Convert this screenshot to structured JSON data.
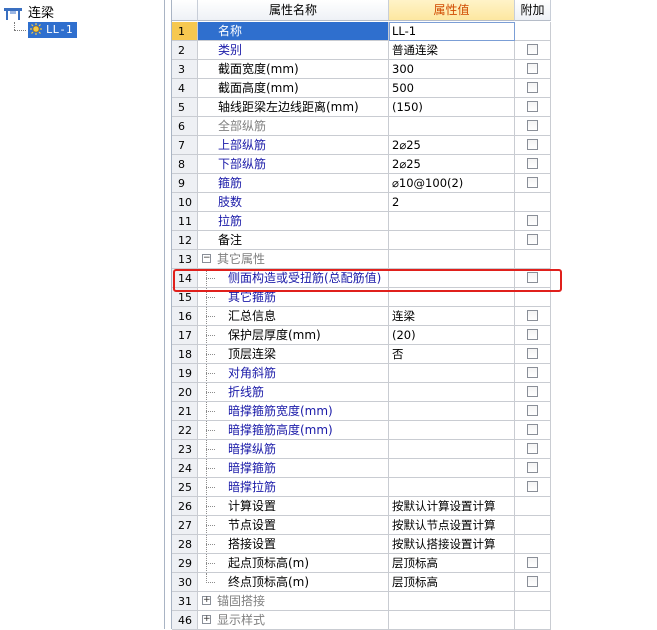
{
  "tree": {
    "root_label": "连梁",
    "child_label": "LL-1"
  },
  "grid": {
    "header": {
      "name": "属性名称",
      "value": "属性值",
      "extra": "附加"
    },
    "rows": [
      {
        "num": "1",
        "name": "名称",
        "value": "LL-1",
        "color": "blue",
        "checkbox": false,
        "tree": "",
        "selected": true
      },
      {
        "num": "2",
        "name": "类别",
        "value": "普通连梁",
        "color": "blue",
        "checkbox": true,
        "tree": ""
      },
      {
        "num": "3",
        "name": "截面宽度(mm)",
        "value": "300",
        "color": "black",
        "checkbox": true,
        "tree": ""
      },
      {
        "num": "4",
        "name": "截面高度(mm)",
        "value": "500",
        "color": "black",
        "checkbox": true,
        "tree": ""
      },
      {
        "num": "5",
        "name": "轴线距梁左边线距离(mm)",
        "value": "(150)",
        "color": "black",
        "checkbox": true,
        "tree": ""
      },
      {
        "num": "6",
        "name": "全部纵筋",
        "value": "",
        "color": "gray",
        "checkbox": true,
        "tree": ""
      },
      {
        "num": "7",
        "name": "上部纵筋",
        "value": "2⌀25",
        "color": "blue",
        "checkbox": true,
        "tree": ""
      },
      {
        "num": "8",
        "name": "下部纵筋",
        "value": "2⌀25",
        "color": "blue",
        "checkbox": true,
        "tree": ""
      },
      {
        "num": "9",
        "name": "箍筋",
        "value": "⌀10@100(2)",
        "color": "blue",
        "checkbox": true,
        "tree": ""
      },
      {
        "num": "10",
        "name": "肢数",
        "value": "2",
        "color": "blue",
        "checkbox": false,
        "tree": ""
      },
      {
        "num": "11",
        "name": "拉筋",
        "value": "",
        "color": "blue",
        "checkbox": true,
        "tree": ""
      },
      {
        "num": "12",
        "name": "备注",
        "value": "",
        "color": "black",
        "checkbox": true,
        "tree": ""
      },
      {
        "num": "13",
        "name": "其它属性",
        "value": "",
        "color": "gray",
        "checkbox": false,
        "tree": "collapse"
      },
      {
        "num": "14",
        "name": "侧面构造或受扭筋(总配筋值)",
        "value": "",
        "color": "blue",
        "checkbox": true,
        "tree": "line"
      },
      {
        "num": "15",
        "name": "其它箍筋",
        "value": "",
        "color": "blue",
        "checkbox": false,
        "tree": "line"
      },
      {
        "num": "16",
        "name": "汇总信息",
        "value": "连梁",
        "color": "black",
        "checkbox": true,
        "tree": "line"
      },
      {
        "num": "17",
        "name": "保护层厚度(mm)",
        "value": "(20)",
        "color": "black",
        "checkbox": true,
        "tree": "line"
      },
      {
        "num": "18",
        "name": "顶层连梁",
        "value": "否",
        "color": "black",
        "checkbox": true,
        "tree": "line"
      },
      {
        "num": "19",
        "name": "对角斜筋",
        "value": "",
        "color": "blue",
        "checkbox": true,
        "tree": "line"
      },
      {
        "num": "20",
        "name": "折线筋",
        "value": "",
        "color": "blue",
        "checkbox": true,
        "tree": "line"
      },
      {
        "num": "21",
        "name": "暗撑箍筋宽度(mm)",
        "value": "",
        "color": "blue",
        "checkbox": true,
        "tree": "line"
      },
      {
        "num": "22",
        "name": "暗撑箍筋高度(mm)",
        "value": "",
        "color": "blue",
        "checkbox": true,
        "tree": "line"
      },
      {
        "num": "23",
        "name": "暗撑纵筋",
        "value": "",
        "color": "blue",
        "checkbox": true,
        "tree": "line"
      },
      {
        "num": "24",
        "name": "暗撑箍筋",
        "value": "",
        "color": "blue",
        "checkbox": true,
        "tree": "line"
      },
      {
        "num": "25",
        "name": "暗撑拉筋",
        "value": "",
        "color": "blue",
        "checkbox": true,
        "tree": "line"
      },
      {
        "num": "26",
        "name": "计算设置",
        "value": "按默认计算设置计算",
        "color": "black",
        "checkbox": false,
        "tree": "line"
      },
      {
        "num": "27",
        "name": "节点设置",
        "value": "按默认节点设置计算",
        "color": "black",
        "checkbox": false,
        "tree": "line"
      },
      {
        "num": "28",
        "name": "搭接设置",
        "value": "按默认搭接设置计算",
        "color": "black",
        "checkbox": false,
        "tree": "line"
      },
      {
        "num": "29",
        "name": "起点顶标高(m)",
        "value": "层顶标高",
        "color": "black",
        "checkbox": true,
        "tree": "line"
      },
      {
        "num": "30",
        "name": "终点顶标高(m)",
        "value": "层顶标高",
        "color": "black",
        "checkbox": true,
        "tree": "last"
      },
      {
        "num": "31",
        "name": "锚固搭接",
        "value": "",
        "color": "gray",
        "checkbox": false,
        "tree": "expand"
      },
      {
        "num": "46",
        "name": "显示样式",
        "value": "",
        "color": "gray",
        "checkbox": false,
        "tree": "expand"
      }
    ]
  },
  "colors": {
    "selection": "#2f6fce",
    "highlight_border": "#e0201c",
    "blue_text": "#1a1aa8",
    "value_header": "#d04a00"
  }
}
